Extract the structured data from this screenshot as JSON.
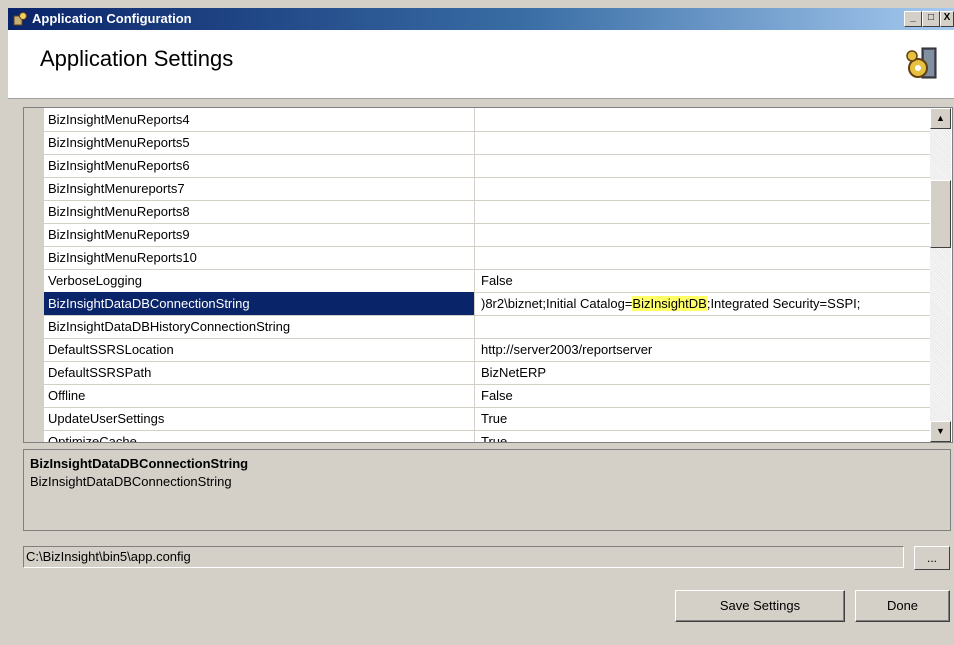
{
  "window": {
    "title": "Application Configuration",
    "min_label": "_",
    "max_label": "□",
    "close_label": "X"
  },
  "header": {
    "title": "Application Settings"
  },
  "settings": [
    {
      "name": "BizInsightMenuReports4",
      "value": ""
    },
    {
      "name": "BizInsightMenuReports5",
      "value": ""
    },
    {
      "name": "BizInsightMenuReports6",
      "value": ""
    },
    {
      "name": "BizInsightMenureports7",
      "value": ""
    },
    {
      "name": "BizInsightMenuReports8",
      "value": ""
    },
    {
      "name": "BizInsightMenuReports9",
      "value": ""
    },
    {
      "name": "BizInsightMenuReports10",
      "value": ""
    },
    {
      "name": "VerboseLogging",
      "value": "False"
    },
    {
      "name": "BizInsightDataDBConnectionString",
      "value_parts": [
        ")8r2\\biznet;Initial Catalog=",
        "BizInsightDB",
        ";Integrated Security=SSPI;"
      ]
    },
    {
      "name": "BizInsightDataDBHistoryConnectionString",
      "value": ""
    },
    {
      "name": "DefaultSSRSLocation",
      "value": "http://server2003/reportserver"
    },
    {
      "name": "DefaultSSRSPath",
      "value": "BizNetERP"
    },
    {
      "name": "Offline",
      "value": "False"
    },
    {
      "name": "UpdateUserSettings",
      "value": "True"
    },
    {
      "name": "OptimizeCache",
      "value": "True"
    }
  ],
  "selected_index": 8,
  "description": {
    "title": "BizInsightDataDBConnectionString",
    "text": "BizInsightDataDBConnectionString"
  },
  "config_path": "C:\\BizInsight\\bin5\\app.config",
  "browse_label": "...",
  "buttons": {
    "save": "Save Settings",
    "done": "Done"
  },
  "colors": {
    "selection": "#0a246a",
    "highlight": "#ffff66"
  }
}
